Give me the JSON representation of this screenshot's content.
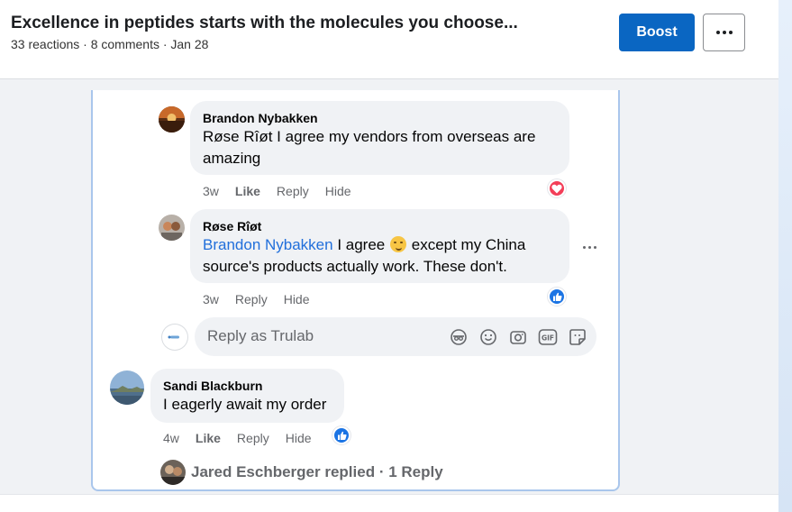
{
  "post": {
    "title": "Excellence in peptides starts with the molecules you choose...",
    "meta": "33 reactions · 8 comments · Jan 28",
    "boost_label": "Boost"
  },
  "comments": [
    {
      "author": "Brandon Nybakken",
      "text": "Røse Rîøt I agree my vendors from overseas are amazing",
      "time": "3w",
      "like": "Like",
      "reply": "Reply",
      "hide": "Hide",
      "reaction": "love"
    },
    {
      "author": "Røse Rîøt",
      "mention": "Brandon Nybakken",
      "text_before_emoji": "I agree",
      "text_after_emoji": "except my China source's products actually work. These don't.",
      "time": "3w",
      "reply": "Reply",
      "hide": "Hide",
      "reaction": "like"
    },
    {
      "author": "Sandi Blackburn",
      "text": "I eagerly await my order",
      "time": "4w",
      "like": "Like",
      "reply": "Reply",
      "hide": "Hide",
      "reaction": "like"
    }
  ],
  "reply_box": {
    "placeholder": "Reply as Trulab",
    "tools": [
      "avatar-sticker-icon",
      "emoji-icon",
      "camera-icon",
      "gif-icon",
      "sticker-icon"
    ]
  },
  "replies_summary": {
    "text": "Jared Eschberger replied · 1 Reply"
  },
  "colors": {
    "boost": "#0a66c2",
    "mention": "#216fdb",
    "love": "#f33e58",
    "like": "#1b74e4",
    "panel_border": "#a9c6ec"
  }
}
